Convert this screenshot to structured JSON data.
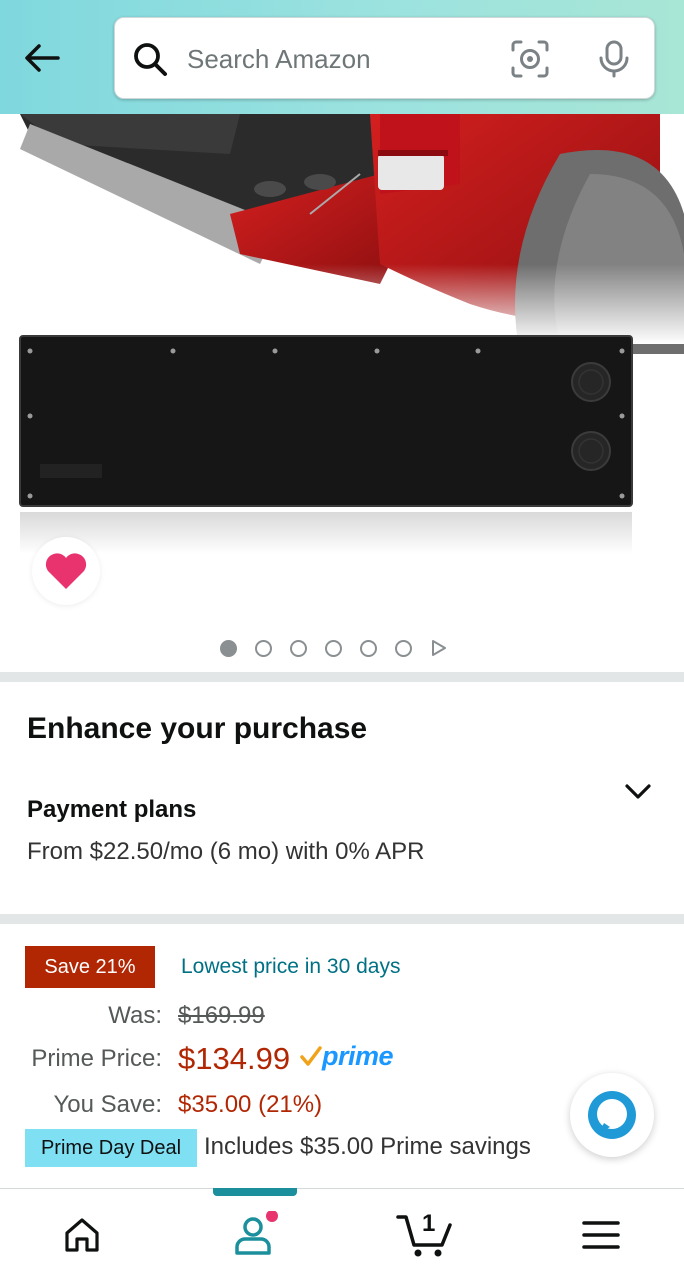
{
  "header": {
    "search_placeholder": "Search Amazon"
  },
  "carousel": {
    "total_images": 6,
    "active_index": 0
  },
  "enhance": {
    "title": "Enhance your purchase",
    "payment_title": "Payment plans",
    "payment_sub": "From $22.50/mo (6 mo) with 0% APR"
  },
  "pricing": {
    "save_badge": "Save 21%",
    "lowest_label": "Lowest price in 30 days",
    "was_label": "Was:",
    "was_value": "$169.99",
    "prime_label": "Prime Price:",
    "prime_value": "$134.99",
    "prime_word": "prime",
    "you_save_label": "You Save:",
    "you_save_value": "$35.00 (21%)",
    "deal_badge": "Prime Day Deal",
    "deal_text": "Includes $35.00 Prime savings"
  },
  "bottom_nav": {
    "cart_count": "1"
  },
  "colors": {
    "accent": "#1b8f9c",
    "price_red": "#b12704",
    "link_teal": "#007185",
    "deal_blue": "#7fe0f3",
    "prime_blue": "#1a98ff",
    "heart_pink": "#e8336f"
  }
}
